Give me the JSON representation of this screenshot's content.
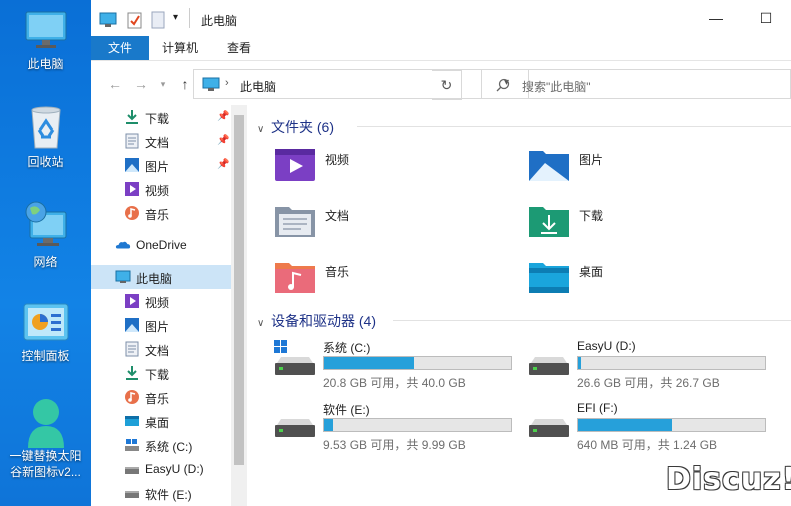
{
  "desktop": {
    "icons": [
      {
        "label": "此电脑",
        "icon": "this-pc-icon"
      },
      {
        "label": "回收站",
        "icon": "recycle-bin-icon"
      },
      {
        "label": "网络",
        "icon": "network-icon"
      },
      {
        "label": "控制面板",
        "icon": "control-panel-icon"
      },
      {
        "label_line1": "一键替换太阳",
        "label_line2": "谷新图标v2...",
        "icon": "user-icon"
      }
    ]
  },
  "window": {
    "title": "此电脑",
    "ribbon_tabs": [
      "文件",
      "计算机",
      "查看"
    ],
    "address": {
      "path": "此电脑"
    },
    "search": {
      "placeholder": "搜索\"此电脑\""
    },
    "nav": {
      "quick_access": [
        {
          "label": "下载",
          "icon": "download-icon",
          "pinned": true
        },
        {
          "label": "文档",
          "icon": "document-icon",
          "pinned": true
        },
        {
          "label": "图片",
          "icon": "pictures-icon",
          "pinned": true
        },
        {
          "label": "视频",
          "icon": "video-icon",
          "pinned": false
        },
        {
          "label": "音乐",
          "icon": "music-icon",
          "pinned": false
        }
      ],
      "onedrive": "OneDrive",
      "this_pc": "此电脑",
      "this_pc_items": [
        {
          "label": "视频",
          "icon": "video-icon"
        },
        {
          "label": "图片",
          "icon": "pictures-icon"
        },
        {
          "label": "文档",
          "icon": "document-icon"
        },
        {
          "label": "下载",
          "icon": "download-icon"
        },
        {
          "label": "音乐",
          "icon": "music-icon"
        },
        {
          "label": "桌面",
          "icon": "desktop-icon"
        },
        {
          "label": "系统 (C:)",
          "icon": "windows-drive-icon"
        },
        {
          "label": "EasyU (D:)",
          "icon": "drive-icon"
        },
        {
          "label": "软件 (E:)",
          "icon": "drive-icon"
        }
      ]
    },
    "content": {
      "folders_header": "文件夹 (6)",
      "folders": [
        {
          "label": "视频",
          "icon": "video-folder-icon"
        },
        {
          "label": "图片",
          "icon": "pictures-folder-icon"
        },
        {
          "label": "文档",
          "icon": "documents-folder-icon"
        },
        {
          "label": "下载",
          "icon": "downloads-folder-icon"
        },
        {
          "label": "音乐",
          "icon": "music-folder-icon"
        },
        {
          "label": "桌面",
          "icon": "desktop-folder-icon"
        }
      ],
      "drives_header": "设备和驱动器 (4)",
      "drives": [
        {
          "label": "系统 (C:)",
          "status": "20.8 GB 可用，共 40.0 GB",
          "used_fraction": 0.48,
          "windows": true
        },
        {
          "label": "EasyU (D:)",
          "status": "26.6 GB 可用，共 26.7 GB",
          "used_fraction": 0.004,
          "windows": false
        },
        {
          "label": "软件 (E:)",
          "status": "9.53 GB 可用，共 9.99 GB",
          "used_fraction": 0.046,
          "windows": false
        },
        {
          "label": "EFI (F:)",
          "status": "640 MB 可用，共 1.24 GB",
          "used_fraction": 0.5,
          "windows": false
        }
      ]
    }
  },
  "colors": {
    "accent": "#1979ca",
    "drive_fill": "#26a0da",
    "selection": "#cce4f7",
    "desktop": "#0f74d8"
  },
  "watermark": "Discuz!"
}
